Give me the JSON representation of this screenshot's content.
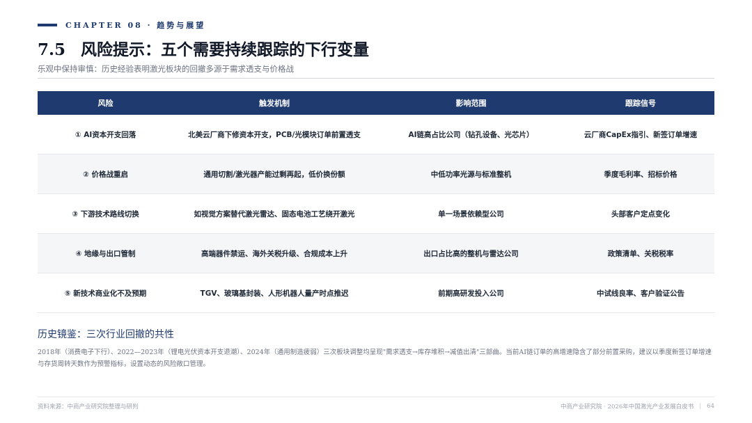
{
  "header": {
    "chapter": "CHAPTER 08 · 趋势与展望",
    "section_num": "7.5",
    "title": "风险提示：五个需要持续跟踪的下行变量",
    "subtitle": "乐观中保持审慎：历史经验表明激光板块的回撤多源于需求透支与价格战"
  },
  "table": {
    "headers": [
      "风险",
      "触发机制",
      "影响范围",
      "跟踪信号"
    ],
    "rows": [
      [
        "① AI资本开支回落",
        "北美云厂商下修资本开支，PCB/光模块订单前置透支",
        "AI链高占比公司（钻孔设备、光芯片）",
        "云厂商CapEx指引、新签订单增速"
      ],
      [
        "② 价格战重启",
        "通用切割/激光器产能过剩再起，低价换份额",
        "中低功率光源与标准整机",
        "季度毛利率、招标价格"
      ],
      [
        "③ 下游技术路线切换",
        "如视觉方案替代激光雷达、固态电池工艺绕开激光",
        "单一场景依赖型公司",
        "头部客户定点变化"
      ],
      [
        "④ 地缘与出口管制",
        "高端器件禁运、海外关税升级、合规成本上升",
        "出口占比高的整机与雷达公司",
        "政策清单、关税税率"
      ],
      [
        "⑤ 新技术商业化不及预期",
        "TGV、玻璃基封装、人形机器人量产时点推迟",
        "前期高研发投入公司",
        "中试线良率、客户验证公告"
      ]
    ]
  },
  "history": {
    "title": "历史镜鉴：三次行业回撤的共性",
    "text": "2018年（消费电子下行）、2022—2023年（锂电光伏资本开支退潮）、2024年（通用制造疲弱）三次板块调整均呈现\"需求透支→库存堆积→减值出清\"三部曲。当前AI链订单的高增速隐含了部分前置采购，建议以季度新签订单增速与存货周转天数作为预警指标，设置动态的风险敞口管理。"
  },
  "footer": {
    "source": "资料来源：中商产业研究院整理与研判",
    "publisher": "中商产业研究院 · 2026年中国激光产业发展白皮书",
    "separator": "|",
    "page": "64"
  }
}
